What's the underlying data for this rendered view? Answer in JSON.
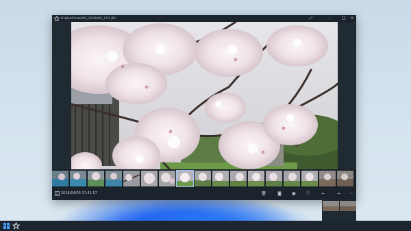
{
  "window": {
    "title": "D:\\Work\\Photo\\IMG_20160403_1741.JPG",
    "app_icon": "photos-star-icon",
    "controls": [
      "expand-icon",
      "minimize-icon",
      "close-icon"
    ]
  },
  "photo": {
    "subject": "cherry blossoms"
  },
  "filmstrip": {
    "thumbnail_count": 17,
    "active_index": 7
  },
  "statusbar": {
    "date": "2016/04/03 17:41:57",
    "actions": [
      "delete-icon",
      "camera-icon",
      "slideshow-icon",
      "info-icon",
      "previous-icon",
      "next-icon",
      "more-icon"
    ]
  },
  "taskbar": {
    "items": [
      "start-icon",
      "photos-icon"
    ]
  },
  "colors": {
    "window_bg": "#1f2a33",
    "accent": "#1a5af0"
  }
}
